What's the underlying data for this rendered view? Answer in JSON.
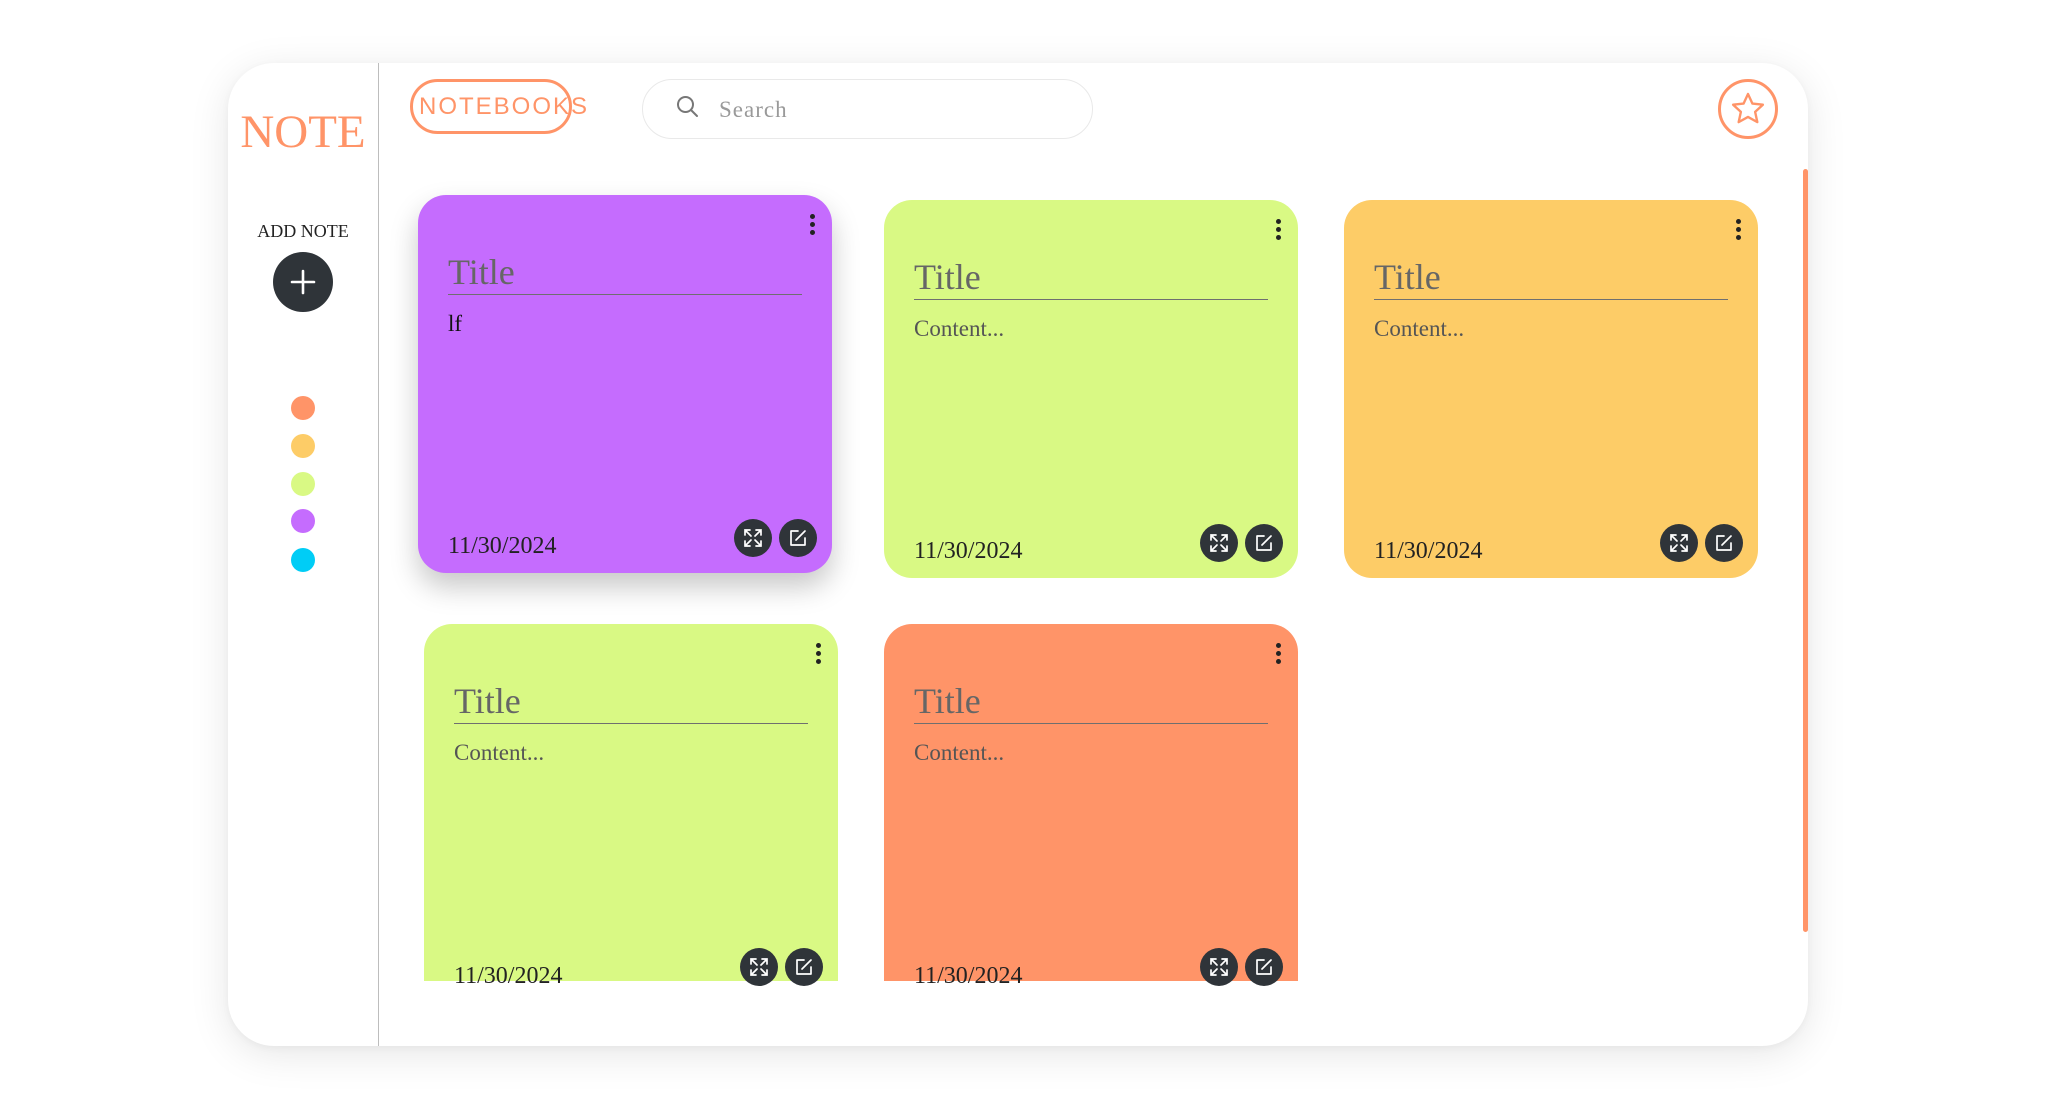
{
  "sidebar": {
    "logo": "NOTE",
    "add_note_label": "ADD NOTE",
    "add_icon": "plus-icon",
    "swatches": [
      {
        "name": "orange",
        "color": "#ff9468"
      },
      {
        "name": "yellow",
        "color": "#fdcc67"
      },
      {
        "name": "lime",
        "color": "#d9f984"
      },
      {
        "name": "purple",
        "color": "#c56cfe"
      },
      {
        "name": "cyan",
        "color": "#00cdf6"
      }
    ]
  },
  "header": {
    "notebooks_label": "NOTEBOOKS",
    "search_placeholder": "Search",
    "search_value": "",
    "search_icon": "search-icon",
    "favorites_icon": "star-icon"
  },
  "colors": {
    "accent": "#ff9468",
    "icon_button": "#2f3439"
  },
  "notes": [
    {
      "color": "#c56cfe",
      "title_placeholder": "Title",
      "title": "",
      "content_placeholder": "Content...",
      "content": "lf",
      "date": "11/30/2024"
    },
    {
      "color": "#d9f984",
      "title_placeholder": "Title",
      "title": "",
      "content_placeholder": "Content...",
      "content": "",
      "date": "11/30/2024"
    },
    {
      "color": "#fdcc67",
      "title_placeholder": "Title",
      "title": "",
      "content_placeholder": "Content...",
      "content": "",
      "date": "11/30/2024"
    },
    {
      "color": "#d9f984",
      "title_placeholder": "Title",
      "title": "",
      "content_placeholder": "Content...",
      "content": "",
      "date": "11/30/2024"
    },
    {
      "color": "#ff9468",
      "title_placeholder": "Title",
      "title": "",
      "content_placeholder": "Content...",
      "content": "",
      "date": "11/30/2024"
    }
  ]
}
